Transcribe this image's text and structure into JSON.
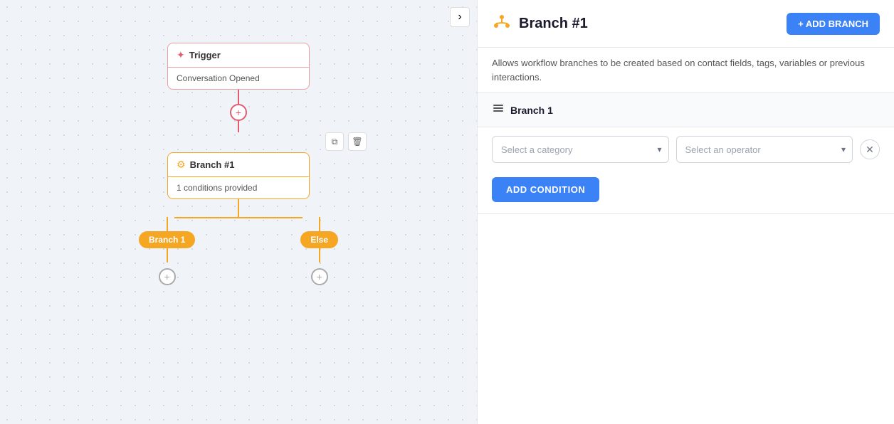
{
  "canvas": {
    "collapse_btn_icon": "›",
    "trigger": {
      "icon": "✦",
      "title": "Trigger",
      "body": "Conversation Opened"
    },
    "branch": {
      "icon": "⚙",
      "title": "Branch #1",
      "body": "1 conditions provided"
    },
    "outputs": [
      {
        "label": "Branch 1"
      },
      {
        "label": "Else"
      }
    ],
    "copy_icon": "⧉",
    "delete_icon": "🗑"
  },
  "panel": {
    "icon": "⚙",
    "title": "Branch #1",
    "add_branch_label": "+ ADD BRANCH",
    "description": "Allows workflow branches to be created based on contact fields, tags, variables or previous interactions.",
    "branch_section": {
      "icon": "≡",
      "title": "Branch 1",
      "category_placeholder": "Select a category",
      "operator_placeholder": "Select an operator",
      "add_condition_label": "ADD CONDITION"
    }
  }
}
